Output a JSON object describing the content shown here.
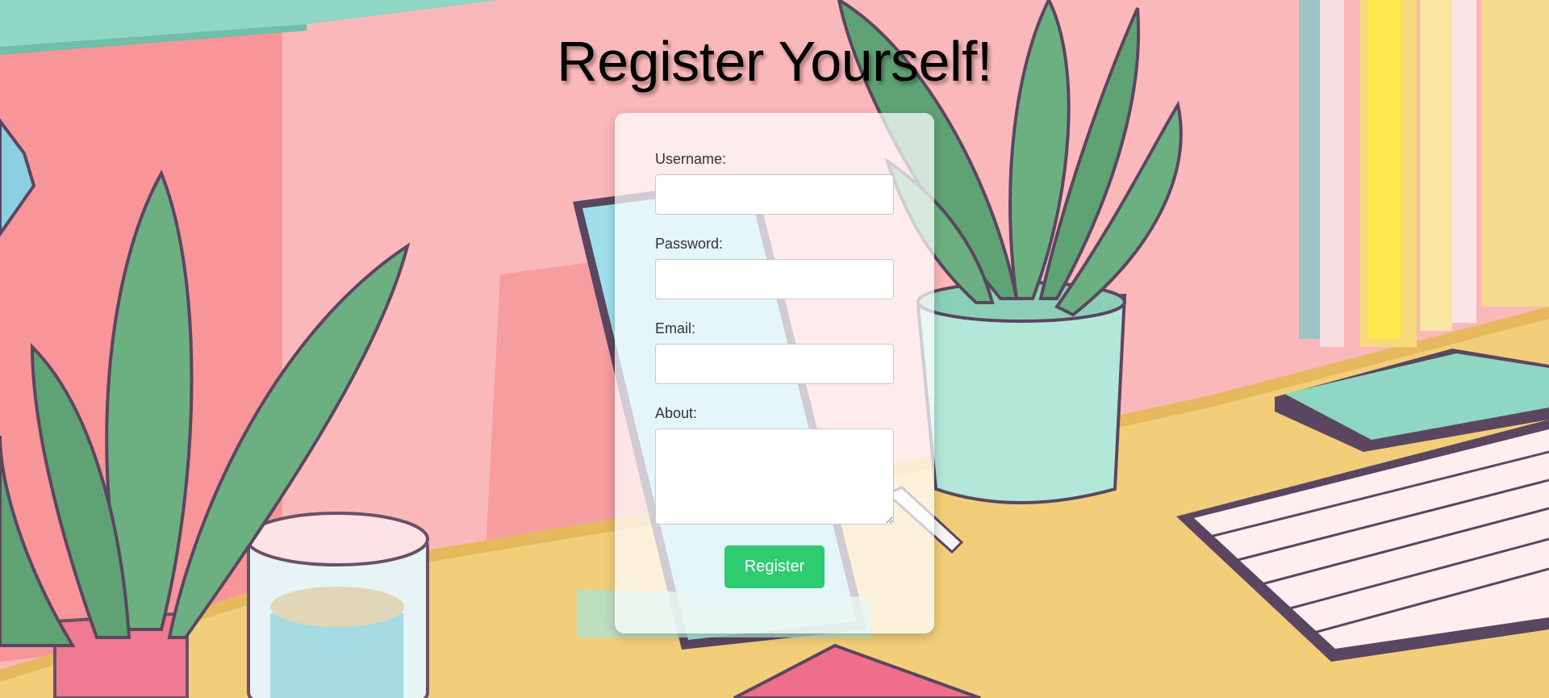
{
  "page": {
    "title": "Register Yourself!"
  },
  "form": {
    "fields": [
      {
        "label": "Username:",
        "value": "",
        "type": "text"
      },
      {
        "label": "Password:",
        "value": "",
        "type": "password"
      },
      {
        "label": "Email:",
        "value": "",
        "type": "email"
      },
      {
        "label": "About:",
        "value": "",
        "type": "textarea"
      }
    ],
    "submit_label": "Register"
  },
  "colors": {
    "accent": "#2ecc71",
    "wall": "#fbb4b6",
    "desk": "#f2ce7a"
  }
}
